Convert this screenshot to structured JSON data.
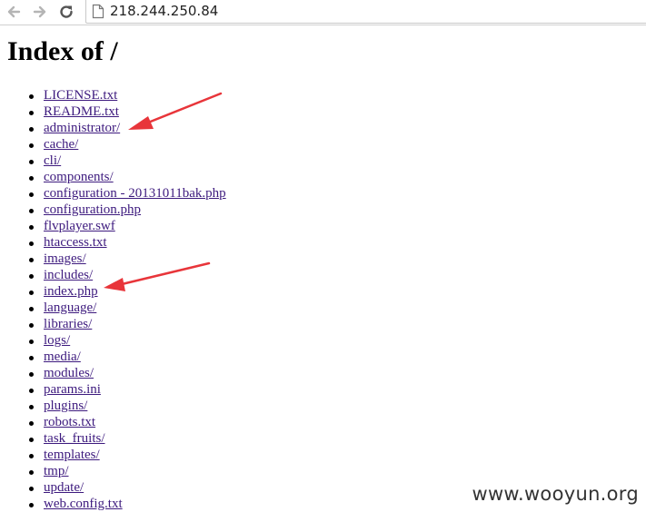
{
  "browser": {
    "url": "218.244.250.84",
    "icons": {
      "back": "arrow-left-icon",
      "forward": "arrow-right-icon",
      "reload": "reload-icon",
      "page": "page-icon"
    }
  },
  "page": {
    "heading": "Index of /",
    "files": [
      "LICENSE.txt",
      "README.txt",
      "administrator/",
      "cache/",
      "cli/",
      "components/",
      "configuration - 20131011bak.php",
      "configuration.php",
      "flvplayer.swf",
      "htaccess.txt",
      "images/",
      "includes/",
      "index.php",
      "language/",
      "libraries/",
      "logs/",
      "media/",
      "modules/",
      "params.ini",
      "plugins/",
      "robots.txt",
      "task_fruits/",
      "templates/",
      "tmp/",
      "update/",
      "web.config.txt"
    ],
    "highlighted": [
      "administrator/",
      "index.php"
    ]
  },
  "colors": {
    "link": "#3d1a7e",
    "annotation_arrow": "#e8353a"
  },
  "watermark": "www.wooyun.org"
}
